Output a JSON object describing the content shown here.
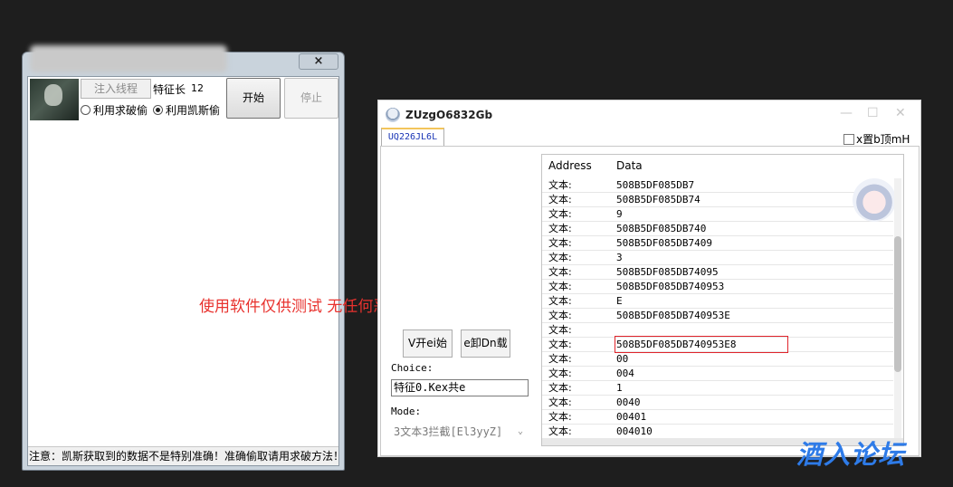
{
  "left_window": {
    "close_glyph": "×",
    "inject_button": "注入线程",
    "feature_label": "特征长",
    "feature_value": "12",
    "radio_crack": "利用求破偷",
    "radio_kaisi": "利用凯斯偷",
    "start_button": "开始",
    "stop_button": "停止",
    "status_text": "注意：凯斯获取到的数据不是特别准确！准确偷取请用求破方法！"
  },
  "notice_text": "使用软件仅供测试 无任何恶意",
  "right_window": {
    "title": "ZUzgO6832Gb",
    "minimize_glyph": "—",
    "maximize_glyph": "☐",
    "close_glyph": "✕",
    "tab_label": "UQ226JL6L",
    "topmost_checkbox": "x置b顶mH",
    "start_button": "V开ei始",
    "unload_button": "e卸Dn载",
    "choice_label": "Choice:",
    "choice_value": "特征0.Kex共e",
    "mode_label": "Mode:",
    "mode_value": "3文本3拦截[El3yyZ]",
    "list": {
      "col_address": "Address",
      "col_data": "Data",
      "rows": [
        {
          "k": "文本:",
          "v": "508B5DF085DB7"
        },
        {
          "k": "文本:",
          "v": "508B5DF085DB74"
        },
        {
          "k": "文本:",
          "v": "9"
        },
        {
          "k": "文本:",
          "v": "508B5DF085DB740"
        },
        {
          "k": "文本:",
          "v": "508B5DF085DB7409"
        },
        {
          "k": "文本:",
          "v": "3"
        },
        {
          "k": "文本:",
          "v": "508B5DF085DB74095"
        },
        {
          "k": "文本:",
          "v": "508B5DF085DB740953"
        },
        {
          "k": "文本:",
          "v": "E"
        },
        {
          "k": "文本:",
          "v": "508B5DF085DB740953E"
        },
        {
          "k": "文本:",
          "v": ""
        },
        {
          "k": "文本:",
          "v": "508B5DF085DB740953E8"
        },
        {
          "k": "文本:",
          "v": "00"
        },
        {
          "k": "文本:",
          "v": "004"
        },
        {
          "k": "文本:",
          "v": "1"
        },
        {
          "k": "文本:",
          "v": "0040"
        },
        {
          "k": "文本:",
          "v": "00401"
        },
        {
          "k": "文本:",
          "v": "004010"
        }
      ],
      "selected_index": 11
    }
  },
  "watermark": "酒入论坛"
}
